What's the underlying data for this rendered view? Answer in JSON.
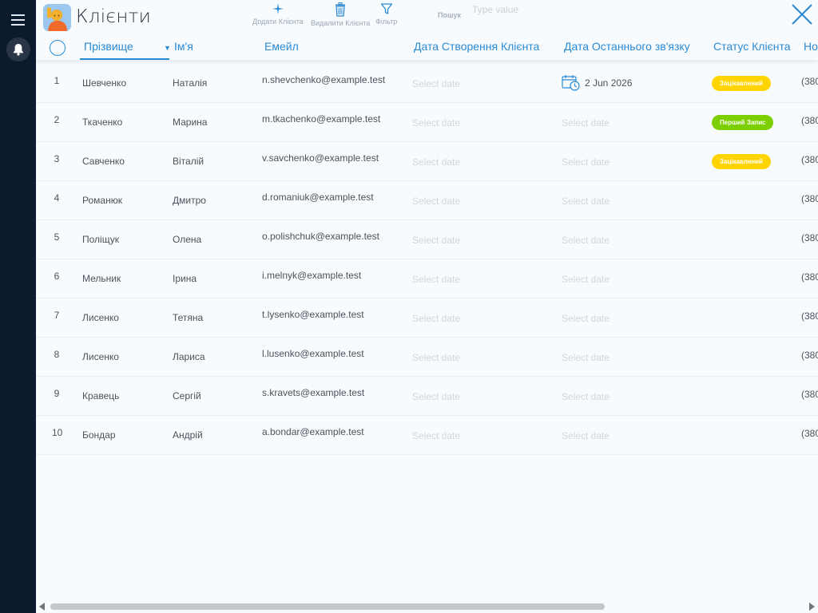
{
  "app": {
    "title": "Клієнти",
    "icon": "person-raising-hand-icon"
  },
  "toolbar": {
    "add_label": "Додати Клієнта",
    "delete_label": "Видалити Клієнта",
    "filter_label": "Фільтр",
    "search_label": "Пошук",
    "search_placeholder": "Type value",
    "search_value": ""
  },
  "colors": {
    "accent": "#2a8ad4",
    "sidebar": "#0b1a2c",
    "status_interested": "#ffd400",
    "status_first_record": "#7ccf00"
  },
  "table": {
    "columns": {
      "surname": "Прізвище",
      "firstname": "Ім'я",
      "email": "Емейл",
      "created": "Дата Створення Клієнта",
      "last_contact": "Дата Останнього зв'язку",
      "status": "Статус Клієнта",
      "phone": "Номер"
    },
    "sort": {
      "column": "surname",
      "direction": "desc"
    },
    "date_placeholder": "Select date",
    "rows": [
      {
        "num": "1",
        "surname": "Шевченко",
        "firstname": "Наталія",
        "email": "n.shevchenko@example.test",
        "created": "",
        "last_contact": "2 Jun 2026",
        "status": "Зацікавлений",
        "status_color": "#ffd400",
        "phone": "(380"
      },
      {
        "num": "2",
        "surname": "Ткаченко",
        "firstname": "Марина",
        "email": "m.tkachenko@example.test",
        "created": "",
        "last_contact": "",
        "status": "Перший Запис",
        "status_color": "#7ccf00",
        "phone": "(380"
      },
      {
        "num": "3",
        "surname": "Савченко",
        "firstname": "Віталій",
        "email": "v.savchenko@example.test",
        "created": "",
        "last_contact": "",
        "status": "Зацікавлений",
        "status_color": "#ffd400",
        "phone": "(380"
      },
      {
        "num": "4",
        "surname": "Романюк",
        "firstname": "Дмитро",
        "email": "d.romaniuk@example.test",
        "created": "",
        "last_contact": "",
        "status": "",
        "status_color": "",
        "phone": "(380"
      },
      {
        "num": "5",
        "surname": "Поліщук",
        "firstname": "Олена",
        "email": "o.polishchuk@example.test",
        "created": "",
        "last_contact": "",
        "status": "",
        "status_color": "",
        "phone": "(380"
      },
      {
        "num": "6",
        "surname": "Мельник",
        "firstname": "Ірина",
        "email": "i.melnyk@example.test",
        "created": "",
        "last_contact": "",
        "status": "",
        "status_color": "",
        "phone": "(380"
      },
      {
        "num": "7",
        "surname": "Лисенко",
        "firstname": "Тетяна",
        "email": "t.lysenko@example.test",
        "created": "",
        "last_contact": "",
        "status": "",
        "status_color": "",
        "phone": "(380"
      },
      {
        "num": "8",
        "surname": "Лисенко",
        "firstname": "Лариса",
        "email": "l.lusenko@example.test",
        "created": "",
        "last_contact": "",
        "status": "",
        "status_color": "",
        "phone": "(380"
      },
      {
        "num": "9",
        "surname": "Кравець",
        "firstname": "Сергій",
        "email": "s.kravets@example.test",
        "created": "",
        "last_contact": "",
        "status": "",
        "status_color": "",
        "phone": "(380"
      },
      {
        "num": "10",
        "surname": "Бондар",
        "firstname": "Андрій",
        "email": "a.bondar@example.test",
        "created": "",
        "last_contact": "",
        "status": "",
        "status_color": "",
        "phone": "(380"
      }
    ]
  },
  "scrollbar": {
    "horizontal_fraction_visible": 0.73,
    "horizontal_position": 0
  }
}
